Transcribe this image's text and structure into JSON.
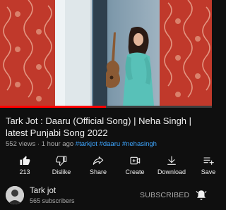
{
  "video": {
    "progress_fraction": 0.5,
    "colors": {
      "wallpaper": "#c0392b",
      "accent_red": "#ff0000"
    }
  },
  "title": "Tark Jot : Daaru (Official Song) |  Neha Singh | latest Punjabi Song 2022",
  "meta": {
    "views": "552 views",
    "age": "1 hour ago",
    "hashtags": [
      "#tarkjot",
      "#daaru",
      "#nehasingh"
    ]
  },
  "actions": [
    {
      "icon": "thumbs-up-icon",
      "label": "213"
    },
    {
      "icon": "thumbs-down-icon",
      "label": "Dislike"
    },
    {
      "icon": "share-icon",
      "label": "Share"
    },
    {
      "icon": "create-icon",
      "label": "Create"
    },
    {
      "icon": "download-icon",
      "label": "Download"
    },
    {
      "icon": "save-icon",
      "label": "Save"
    }
  ],
  "channel": {
    "name": "Tark jot",
    "subscribers": "565 subscribers",
    "subscribe_label": "SUBSCRIBED",
    "bell_icon": "bell-icon"
  }
}
